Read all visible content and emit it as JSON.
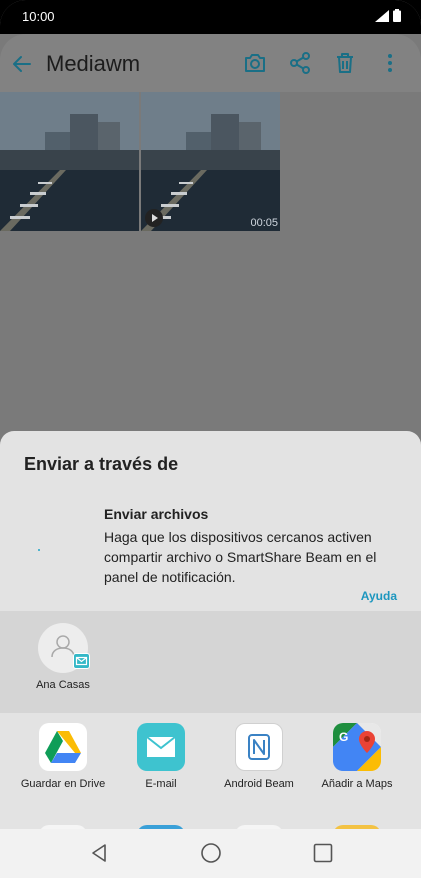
{
  "status": {
    "time": "10:00"
  },
  "appbar": {
    "title": "Mediawm",
    "icons": [
      "back-arrow-icon",
      "camera-icon",
      "share-icon",
      "delete-icon",
      "more-vert-icon"
    ]
  },
  "gallery": {
    "items": [
      {
        "type": "image"
      },
      {
        "type": "video",
        "duration": "00:05"
      }
    ]
  },
  "sheet": {
    "title": "Enviar a través de",
    "send_files": {
      "title": "Enviar archivos",
      "description": "Haga que los dispositivos cercanos activen compartir archivo o SmartShare Beam en el panel de notificación.",
      "help": "Ayuda"
    },
    "contact": {
      "name": "Ana Casas"
    },
    "apps": [
      {
        "label": "Guardar en Drive",
        "icon": "google-drive-icon"
      },
      {
        "label": "E-mail",
        "icon": "email-icon"
      },
      {
        "label": "Android Beam",
        "icon": "android-beam-icon"
      },
      {
        "label": "Añadir a Maps",
        "icon": "google-maps-icon"
      }
    ]
  },
  "colors": {
    "accent": "#1d97bf",
    "sheet_bg": "#e3e3e3",
    "scrim": "#7a7a7a"
  }
}
